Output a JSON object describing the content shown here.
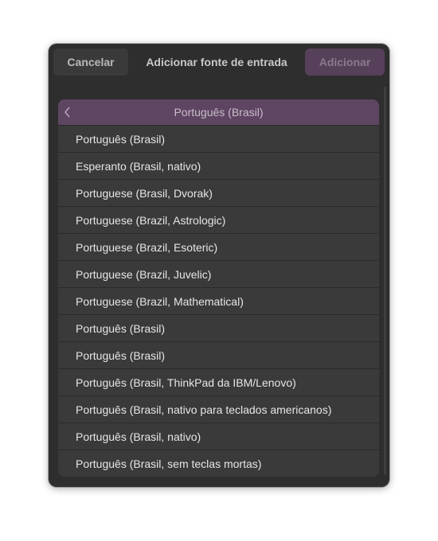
{
  "dialog": {
    "title": "Adicionar fonte de entrada",
    "cancel_label": "Cancelar",
    "add_label": "Adicionar"
  },
  "list": {
    "header": "Português (Brasil)",
    "items": [
      "Português (Brasil)",
      "Esperanto (Brasil, nativo)",
      "Portuguese (Brasil, Dvorak)",
      "Portuguese (Brazil, Astrologic)",
      "Portuguese (Brazil, Esoteric)",
      "Portuguese (Brazil, Juvelic)",
      "Portuguese (Brazil, Mathematical)",
      "Português (Brasil)",
      "Português (Brasil)",
      "Português (Brasil, ThinkPad da IBM/Lenovo)",
      "Português (Brasil, nativo para teclados americanos)",
      "Português (Brasil, nativo)",
      "Português (Brasil, sem teclas mortas)"
    ]
  },
  "icons": {
    "back": "chevron-left-icon"
  },
  "colors": {
    "dialog_bg": "#2e2e2e",
    "list_bg": "#3a3a3a",
    "accent": "#5e4662",
    "add_button": "#57405a"
  }
}
